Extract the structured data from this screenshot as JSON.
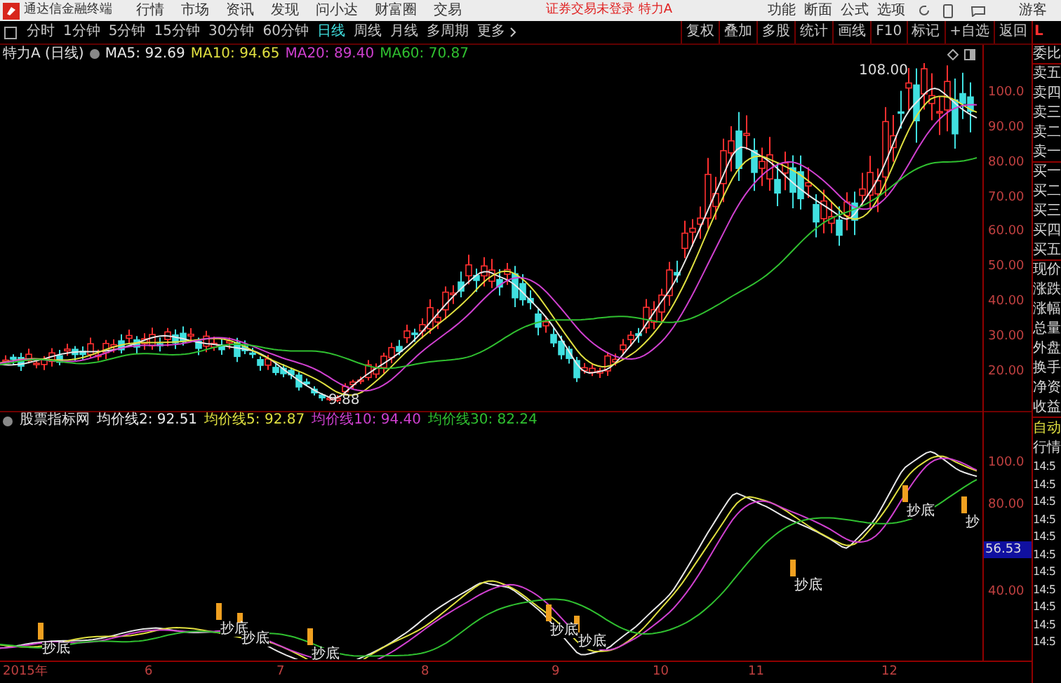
{
  "app_bar": {
    "title": "通达信金融终端",
    "menu": [
      "行情",
      "市场",
      "资讯",
      "发现",
      "问小达",
      "财富圈",
      "交易"
    ],
    "notice": "证券交易未登录 特力A",
    "right_menu": [
      "功能",
      "断面",
      "公式",
      "选项"
    ],
    "user": "游客"
  },
  "period_tabs": [
    {
      "label": "分时",
      "selected": false
    },
    {
      "label": "1分钟",
      "selected": false
    },
    {
      "label": "5分钟",
      "selected": false
    },
    {
      "label": "15分钟",
      "selected": false
    },
    {
      "label": "30分钟",
      "selected": false
    },
    {
      "label": "60分钟",
      "selected": false
    },
    {
      "label": "日线",
      "selected": true
    },
    {
      "label": "周线",
      "selected": false
    },
    {
      "label": "月线",
      "selected": false
    },
    {
      "label": "多周期",
      "selected": false
    },
    {
      "label": "更多",
      "selected": false
    }
  ],
  "tools": [
    "复权",
    "叠加",
    "多股",
    "统计",
    "画线",
    "F10",
    "标记",
    "+自选",
    "返回"
  ],
  "main_chart": {
    "title": "特力A (日线)",
    "averages": [
      {
        "label": "MA5: 92.69",
        "color": "#e8e8e8"
      },
      {
        "label": "MA10: 94.65",
        "color": "#e0e040"
      },
      {
        "label": "MA20: 89.40",
        "color": "#d040d0"
      },
      {
        "label": "MA60: 70.87",
        "color": "#30c030"
      }
    ],
    "high_label": "108.00",
    "low_label": "9.88",
    "price_ticks": [
      "100.0",
      "90.00",
      "80.00",
      "70.00",
      "60.00",
      "50.00",
      "40.00",
      "30.00",
      "20.00"
    ]
  },
  "indicator": {
    "title": "股票指标网",
    "averages": [
      {
        "label": "均价线2: 92.51",
        "color": "#e8e8e8"
      },
      {
        "label": "均价线5: 92.87",
        "color": "#e0e040"
      },
      {
        "label": "均价线10: 94.40",
        "color": "#d040d0"
      },
      {
        "label": "均价线30: 82.24",
        "color": "#30c030"
      }
    ],
    "signals": [
      "抄底",
      "抄底",
      "抄底",
      "抄底",
      "抄底",
      "抄底",
      "抄底",
      "抄底",
      "抄"
    ],
    "ticks": [
      "100.0",
      "80.00",
      "40.00"
    ],
    "current": "56.53"
  },
  "date_axis": [
    "2015年",
    "6",
    "7",
    "8",
    "9",
    "10",
    "11",
    "12"
  ],
  "quote_panel": {
    "corner": "L",
    "labels": [
      "委比",
      "卖五",
      "卖四",
      "卖三",
      "卖二",
      "卖一",
      "买一",
      "买二",
      "买三",
      "买四",
      "买五",
      "现价",
      "涨跌",
      "涨幅",
      "总量",
      "外盘",
      "换手",
      "净资",
      "收益"
    ],
    "auto": "自动",
    "quote": "行情",
    "times": [
      "14:5",
      "14:5",
      "14:5",
      "14:5",
      "14:5",
      "14:5",
      "14:5",
      "14:5",
      "14:5",
      "14:5",
      "14:5"
    ]
  }
}
